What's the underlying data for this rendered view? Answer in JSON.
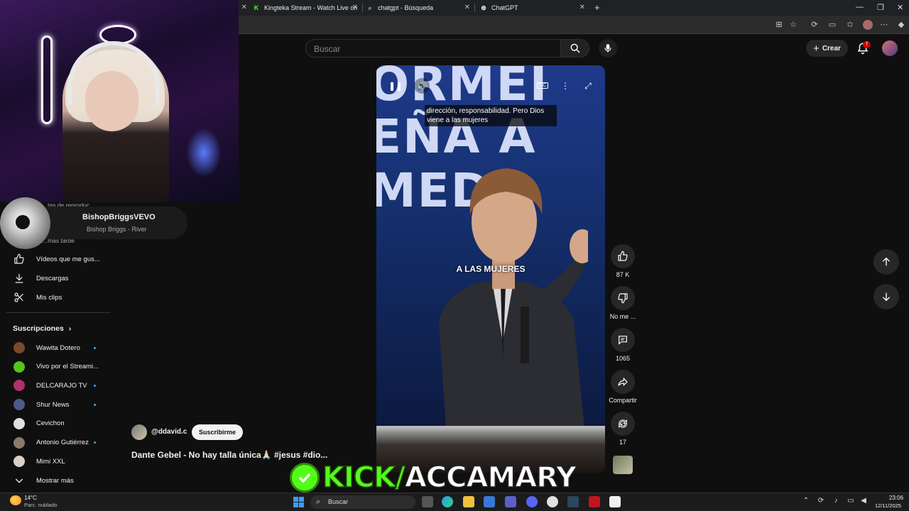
{
  "browser": {
    "tabs": [
      {
        "title": "Kingteka Stream - Watch Live on",
        "icon": "kick-icon",
        "color": "#53fc18"
      },
      {
        "title": "chatgpt - Búsqueda",
        "icon": "search-icon"
      },
      {
        "title": "ChatGPT",
        "icon": "chatgpt-icon"
      }
    ],
    "new_tab": "+",
    "window_controls": {
      "minimize": "—",
      "maximize": "❐",
      "close": "✕"
    }
  },
  "youtube": {
    "search_placeholder": "Buscar",
    "create_label": "Crear",
    "notification_count": "7"
  },
  "music_card": {
    "artist": "BishopBriggsVEVO",
    "song": "Bishop Briggs - River"
  },
  "sidebar": {
    "partial_items": [
      {
        "label": "...tas de reproduc..."
      },
      {
        "label": "...más tarde"
      }
    ],
    "items": [
      {
        "label": "Vídeos que me gus...",
        "icon": "thumbs-up-icon"
      },
      {
        "label": "Descargas",
        "icon": "download-icon"
      },
      {
        "label": "Mis clips",
        "icon": "scissors-icon"
      }
    ],
    "subscriptions_title": "Suscripciones",
    "subscriptions": [
      {
        "label": "Wawita Dotero",
        "new": true,
        "color": "#7a4a2a"
      },
      {
        "label": "Vivo por el Streami...",
        "new": false,
        "color": "#53c418"
      },
      {
        "label": "DELCARAJO TV",
        "new": true,
        "color": "#b03070"
      },
      {
        "label": "Shur News",
        "new": true,
        "color": "#4a5a8a"
      },
      {
        "label": "Cevichon",
        "new": false,
        "color": "#e0e0e0"
      },
      {
        "label": "Antonio Gutiérrez",
        "new": true,
        "color": "#8a7a6a"
      },
      {
        "label": "Mimi XXL",
        "new": false,
        "color": "#d8d0c8"
      }
    ],
    "show_more": "Mostrar más"
  },
  "video": {
    "caption_top": "dirección, responsabilidad. Pero Dios viene a las mujeres",
    "caption_mid": "A LAS MUJERES",
    "background_words": [
      "ORMEI",
      "EÑA A",
      "MEDA"
    ],
    "channel": "@ddavid.c",
    "subscribe_label": "Suscribirme",
    "title": "Dante Gebel - No hay talla única🙏🏻 #jesus #dio..."
  },
  "actions": {
    "likes": "87 K",
    "dislike_label": "No me ...",
    "comments": "1065",
    "share_label": "Compartir",
    "remix": "17"
  },
  "overlay": {
    "kick_part": "KICK/",
    "name_part": "ACCAMARY",
    "accent": "#53fc18"
  },
  "taskbar": {
    "search_placeholder": "Buscar",
    "weather_temp": "14°C",
    "weather_desc": "Parc. nublado",
    "time": "23:06",
    "date": "12/11/2025"
  }
}
